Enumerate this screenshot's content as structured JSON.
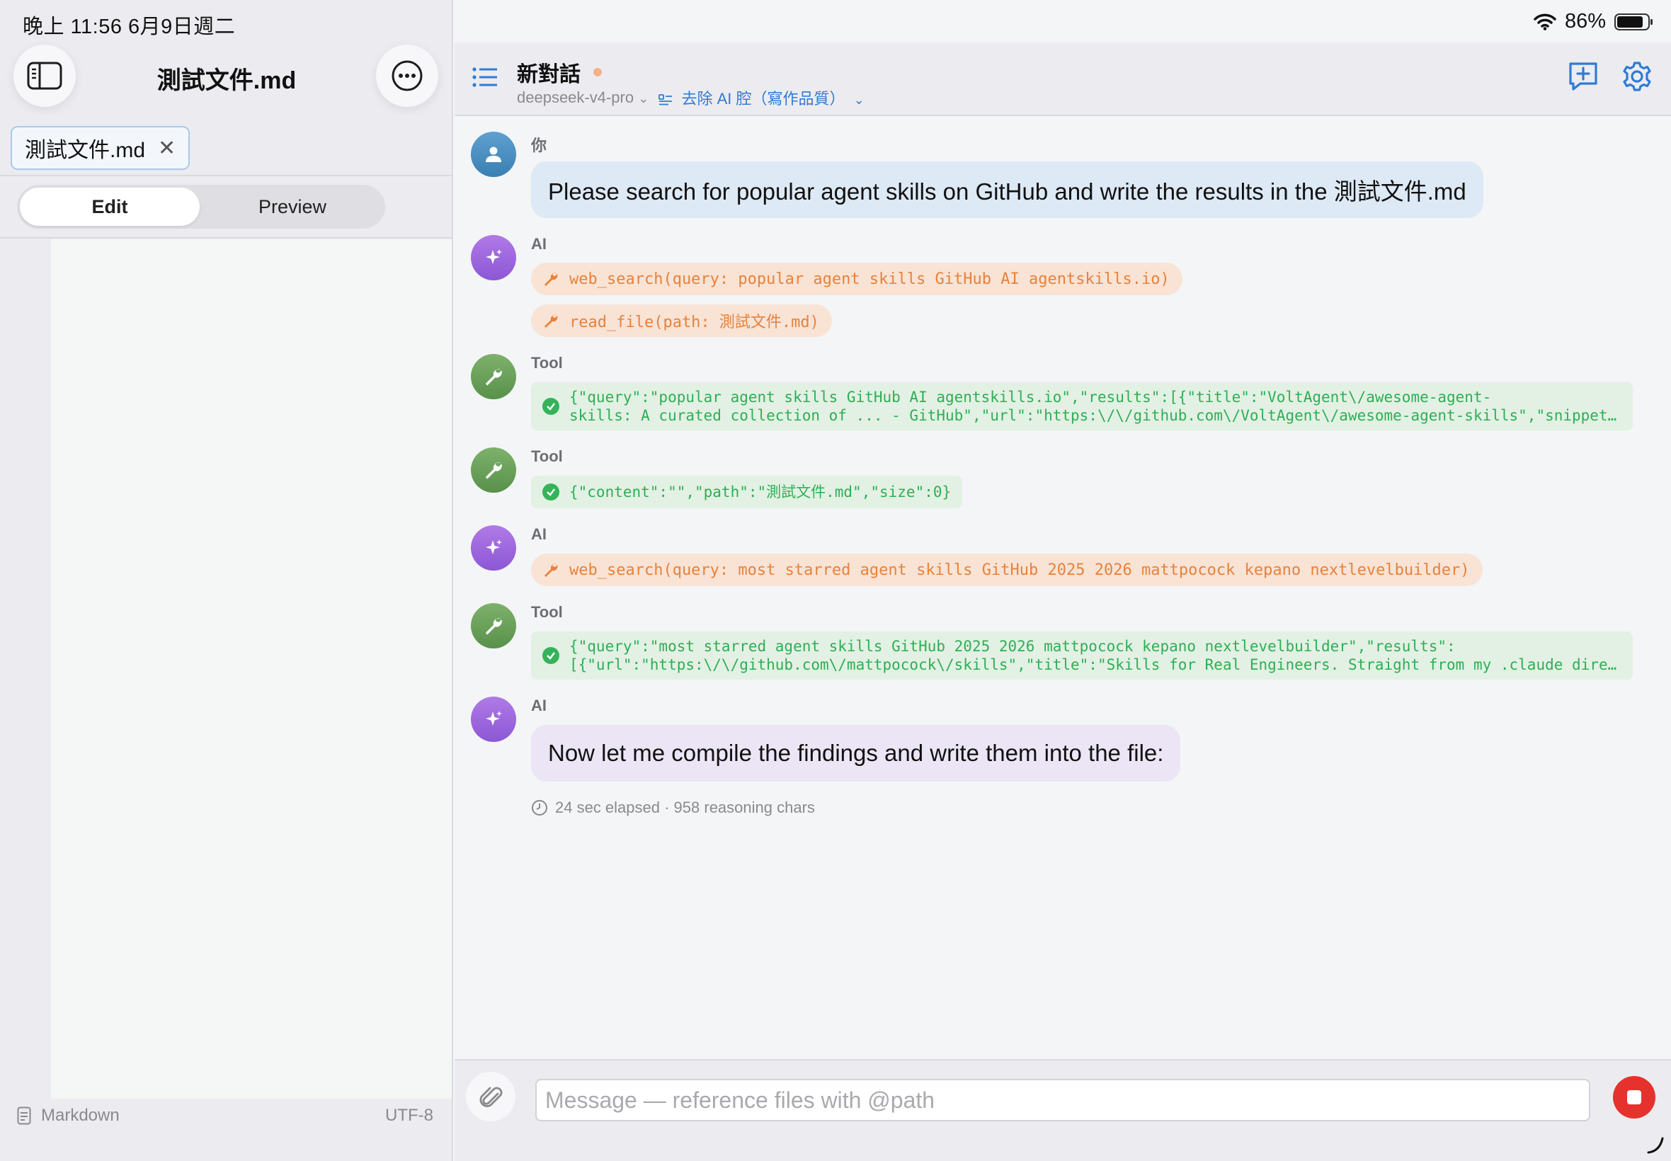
{
  "status_bar": {
    "time_date": "晚上 11:56   6月9日週二",
    "battery": "86%",
    "battery_level": 0.86
  },
  "left_pane": {
    "title": "測試文件.md",
    "open_tab": "測試文件.md",
    "segments": {
      "edit": "Edit",
      "preview": "Preview",
      "selected": "Edit"
    },
    "footer": {
      "language": "Markdown",
      "encoding": "UTF-8"
    }
  },
  "conversation": {
    "title": "新對話",
    "model": "deepseek-v4-pro",
    "mode": "去除 AI 腔（寫作品質）"
  },
  "messages": {
    "m1": {
      "role": "你",
      "text": "Please search for popular agent skills on GitHub and write the results in the 測試文件.md"
    },
    "m2": {
      "role": "AI",
      "call1": "web_search(query: popular agent skills GitHub AI agentskills.io)",
      "call2": "read_file(path: 測試文件.md)"
    },
    "m3": {
      "role": "Tool",
      "line1": "{\"query\":\"popular agent skills GitHub AI agentskills.io\",\"results\":[{\"title\":\"VoltAgent\\/awesome-agent-",
      "line2": "skills: A curated collection of ... - GitHub\",\"url\":\"https:\\/\\/github.com\\/VoltAgent\\/awesome-agent-skills\",\"snippet\":\"...\"}]}"
    },
    "m4": {
      "role": "Tool",
      "line1": "{\"content\":\"\",\"path\":\"測試文件.md\",\"size\":0}"
    },
    "m5": {
      "role": "AI",
      "call1": "web_search(query: most starred agent skills GitHub 2025 2026 mattpocock kepano nextlevelbuilder)"
    },
    "m6": {
      "role": "Tool",
      "line1": "{\"query\":\"most starred agent skills GitHub 2025 2026 mattpocock kepano nextlevelbuilder\",\"results\":",
      "line2": "[{\"url\":\"https:\\/\\/github.com\\/mattpocock\\/skills\",\"title\":\"Skills for Real Engineers. Straight from my .claude directory\"}]}"
    },
    "m7": {
      "role": "AI",
      "text": "Now let me compile the findings and write them into the file:"
    },
    "meta": "24 sec elapsed  · 958 reasoning chars"
  },
  "composer": {
    "placeholder": "Message — reference files with @path",
    "value": ""
  },
  "colors": {
    "accent": "#2f7bd6",
    "tool_call_text": "#e8823a",
    "tool_result_text": "#2fae55",
    "stop_button": "#e5322d"
  },
  "icons": [
    "sidebar-toggle-icon",
    "more-icon",
    "close-icon",
    "list-icon",
    "new-chat-icon",
    "gear-icon",
    "person-icon",
    "sparkle-icon",
    "wrench-icon",
    "check-seal-icon",
    "clock-icon",
    "paperclip-icon",
    "stop-icon",
    "wifi-icon",
    "battery-icon",
    "document-icon"
  ]
}
